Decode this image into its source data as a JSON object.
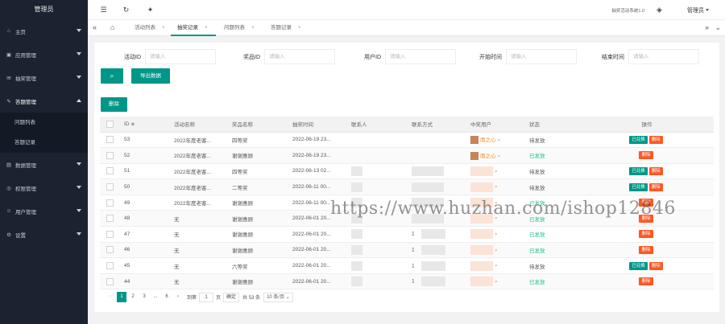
{
  "sidebar": {
    "brand": "管理员",
    "items": [
      {
        "label": "主页",
        "icon": "home-icon"
      },
      {
        "label": "应用管理",
        "icon": "app-icon"
      },
      {
        "label": "抽奖管理",
        "icon": "gift-icon"
      },
      {
        "label": "答题管理",
        "icon": "edit-icon",
        "open": true
      },
      {
        "label": "数据管理",
        "icon": "data-icon"
      },
      {
        "label": "权限管理",
        "icon": "shield-icon"
      },
      {
        "label": "用户管理",
        "icon": "user-icon"
      },
      {
        "label": "设置",
        "icon": "gear-icon"
      }
    ],
    "subitems": [
      "问题列表",
      "答题记录"
    ]
  },
  "topbar": {
    "right_text": "抽奖活动系统1.0",
    "user": "管理员"
  },
  "tabs": [
    {
      "label": "活动列表"
    },
    {
      "label": "抽奖记录",
      "active": true
    },
    {
      "label": "问题列表"
    },
    {
      "label": "答题记录"
    }
  ],
  "filters": [
    {
      "label": "活动ID",
      "placeholder": "请输入"
    },
    {
      "label": "奖品ID",
      "placeholder": "请输入"
    },
    {
      "label": "用户ID",
      "placeholder": "请输入"
    },
    {
      "label": "开始时间",
      "placeholder": "请输入"
    },
    {
      "label": "结束时间",
      "placeholder": "请输入"
    }
  ],
  "buttons": {
    "export": "导出数据",
    "delete": "删除"
  },
  "table": {
    "headers": [
      "ID",
      "活动名称",
      "奖品名称",
      "抽奖时间",
      "联系人",
      "联系方式",
      "中奖用户",
      "状态",
      "操作"
    ],
    "rows": [
      {
        "id": "53",
        "activity": "2022年度老客...",
        "prize": "四等奖",
        "time": "2022-06-19 23...",
        "contact": "",
        "phone": "",
        "winner": "雨之心",
        "status": "待发放",
        "status_type": "wait",
        "ops": [
          "已兑换",
          "删除"
        ]
      },
      {
        "id": "52",
        "activity": "2022年度老客...",
        "prize": "谢谢惠顾",
        "time": "2022-06-19 23...",
        "contact": "",
        "phone": "",
        "winner": "雨之心",
        "status": "已发放",
        "status_type": "done",
        "ops": [
          "删除"
        ]
      },
      {
        "id": "51",
        "activity": "2022年度老客...",
        "prize": "四等奖",
        "time": "2022-06-13 02...",
        "contact": "blur",
        "phone": "blur",
        "winner": "blur",
        "status": "待发放",
        "status_type": "wait",
        "ops": [
          "已兑换",
          "删除"
        ]
      },
      {
        "id": "50",
        "activity": "2022年度老客...",
        "prize": "二等奖",
        "time": "2022-06-11 00...",
        "contact": "blur",
        "phone": "blur",
        "winner": "blur",
        "status": "待发放",
        "status_type": "wait",
        "ops": [
          "已兑换",
          "删除"
        ]
      },
      {
        "id": "49",
        "activity": "2022年度老客...",
        "prize": "谢谢惠顾",
        "time": "2022-06-11 00...",
        "contact": "blur",
        "phone": "blur",
        "winner": "blur",
        "status": "已发放",
        "status_type": "done",
        "ops": [
          "删除"
        ]
      },
      {
        "id": "48",
        "activity": "无",
        "prize": "谢谢惠顾",
        "time": "2022-06-01 20...",
        "contact": "blur",
        "phone": "blur",
        "winner": "blur",
        "status": "已发放",
        "status_type": "done",
        "ops": [
          "删除"
        ]
      },
      {
        "id": "47",
        "activity": "无",
        "prize": "谢谢惠顾",
        "time": "2022-06-01 20...",
        "contact": "blur",
        "phone": "1",
        "winner": "blur",
        "status": "已发放",
        "status_type": "done",
        "ops": [
          "删除"
        ]
      },
      {
        "id": "46",
        "activity": "无",
        "prize": "谢谢惠顾",
        "time": "2022-06-01 20...",
        "contact": "blur",
        "phone": "1",
        "winner": "blur",
        "status": "已发放",
        "status_type": "done",
        "ops": [
          "删除"
        ]
      },
      {
        "id": "45",
        "activity": "无",
        "prize": "六等奖",
        "time": "2022-06-01 20...",
        "contact": "blur",
        "phone": "1",
        "winner": "blur",
        "status": "待发放",
        "status_type": "wait",
        "ops": [
          "已兑换",
          "删除"
        ]
      },
      {
        "id": "44",
        "activity": "无",
        "prize": "谢谢惠顾",
        "time": "2022-06-01 20...",
        "contact": "blur",
        "phone": "1",
        "winner": "blur",
        "status": "已发放",
        "status_type": "done",
        "ops": [
          "删除"
        ]
      }
    ]
  },
  "pagination": {
    "pages": [
      "1",
      "2",
      "3",
      "...",
      "6"
    ],
    "goto_label": "到第",
    "goto_value": "1",
    "page_unit": "页",
    "confirm": "确定",
    "total": "共 53 条",
    "page_size": "10 条/页"
  },
  "watermark": "https://www.huzhan.com/ishop12846"
}
